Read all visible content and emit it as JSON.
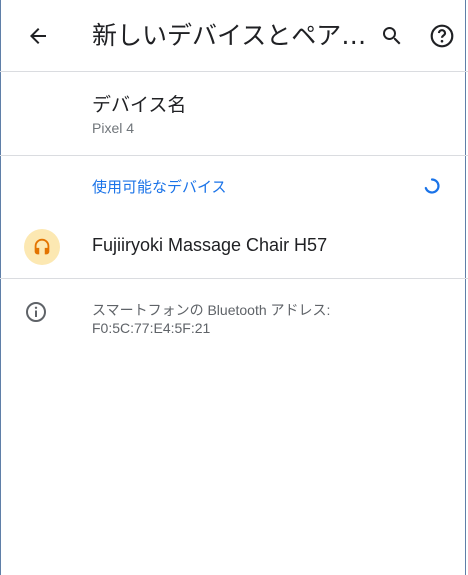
{
  "appbar": {
    "title": "新しいデバイスとペア…",
    "back_icon": "arrow-back-icon",
    "search_icon": "search-icon",
    "help_icon": "help-icon"
  },
  "device_name": {
    "title": "デバイス名",
    "value": "Pixel 4"
  },
  "available": {
    "label": "使用可能なデバイス",
    "accent": "#1a73e8",
    "devices": [
      {
        "name": "Fujiiryoki Massage Chair H57",
        "icon": "headset-icon"
      }
    ]
  },
  "info": {
    "icon": "info-icon",
    "text": "スマートフォンの Bluetooth アドレス: F0:5C:77:E4:5F:21"
  }
}
